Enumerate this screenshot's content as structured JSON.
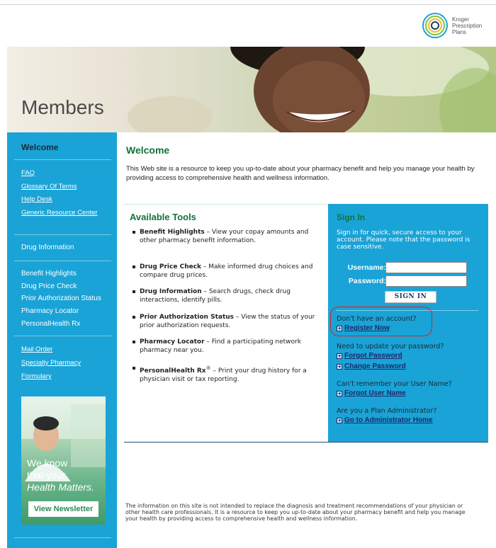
{
  "logo": {
    "line1": "Kroger",
    "line2": "Prescription",
    "line3": "Plans"
  },
  "hero": {
    "title": "Members"
  },
  "sidebar": {
    "welcome": "Welcome",
    "links_group1": [
      "FAQ",
      "Glossary Of Terms",
      "Help Desk",
      "Generic Resource Center"
    ],
    "drug_information": "Drug Information",
    "tools": [
      "Benefit Highlights",
      "Drug Price Check",
      "Prior Authorization Status",
      "Pharmacy Locator",
      "PersonalHealth Rx"
    ],
    "links_group2": [
      "Mail Order",
      "Specialty Pharmacy",
      "Formulary"
    ]
  },
  "ad": {
    "line1": "We know",
    "line2": "that your",
    "line3": "Health Matters.",
    "button": "View Newsletter"
  },
  "main": {
    "title": "Welcome",
    "intro": "This Web site is a resource to keep you up-to-date about your pharmacy benefit and help you manage your health by providing access to comprehensive health and wellness information."
  },
  "tools_panel": {
    "title": "Available Tools",
    "items": [
      {
        "name": "Benefit Highlights",
        "desc": " – View your copay amounts and other pharmacy benefit information."
      },
      {
        "name": "Drug Price Check",
        "desc": " – Make informed drug choices and compare drug prices."
      },
      {
        "name": "Drug Information",
        "desc": " – Search drugs, check drug interactions, identify pills."
      },
      {
        "name": "Prior Authorization Status",
        "desc": " – View the status of your prior authorization requests."
      },
      {
        "name": "Pharmacy Locator",
        "desc": " – Find a participating network pharmacy near you."
      },
      {
        "name": "PersonalHealth Rx",
        "sup": "®",
        "desc": " – Print your drug history for a physician visit or tax reporting."
      }
    ]
  },
  "signin": {
    "title": "Sign In",
    "desc": "Sign in for quick, secure access to your account. Please note that the password is case sensitive.",
    "username_label": "Username:",
    "username_value": "",
    "password_label": "Password:",
    "password_value": "",
    "button": "SIGN IN",
    "no_account_q": "Don't have an account?",
    "register": "Register Now",
    "update_pw_q": "Need to update your password?",
    "forgot_pw": "Forgot Password",
    "change_pw": "Change Password",
    "username_q": "Can't remember your User Name?",
    "forgot_user": "Forgot User Name",
    "admin_q": "Are you a Plan Administrator?",
    "admin_link": "Go to Administrator Home"
  },
  "disclaimer": "The information on this site is not intended to replace the diagnosis and treatment recommendations of your physician or other health care professionals. It is a resource to keep you up-to-date about your pharmacy benefit and help you manage your health by providing access to comprehensive health and wellness information.",
  "colors": {
    "sidebar": "#1aa3d6",
    "heading_green": "#11733c",
    "highlight_red": "#d1262b"
  }
}
